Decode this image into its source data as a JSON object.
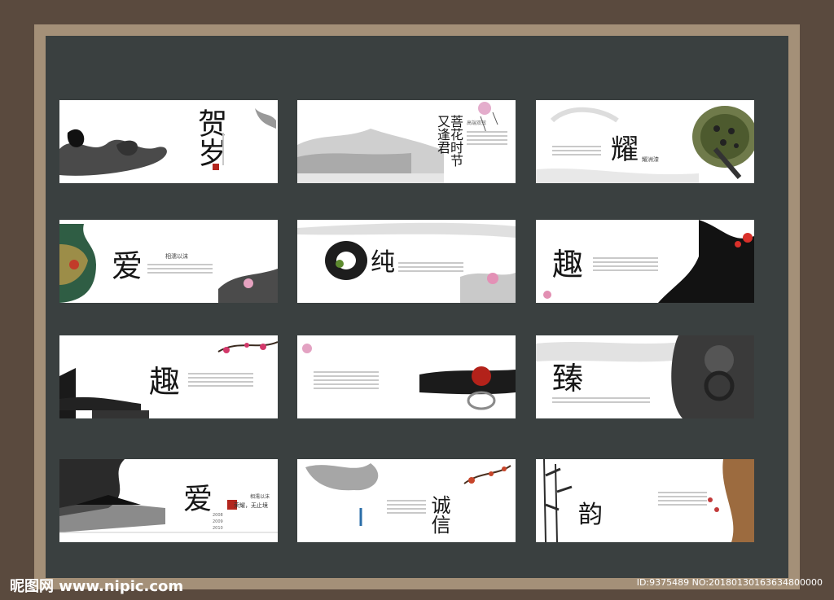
{
  "watermark": {
    "left": "昵图网 www.nipic.com",
    "right": "ID:9375489 NO:20180130163634800000"
  },
  "cards": [
    {
      "title": "贺岁",
      "small": ""
    },
    {
      "title": "菩花时节 又逢君",
      "small": "高端双效"
    },
    {
      "title": "耀",
      "small": "耀洲漆"
    },
    {
      "title": "爱",
      "small": "相濡以沫"
    },
    {
      "title": "纯",
      "small": ""
    },
    {
      "title": "趣",
      "small": ""
    },
    {
      "title": "趣",
      "small": ""
    },
    {
      "title": "",
      "small": ""
    },
    {
      "title": "臻",
      "small": ""
    },
    {
      "title": "爱",
      "small": "相濡以沫",
      "sub": "荣耀，无止境",
      "years": [
        "2008",
        "2009",
        "2010"
      ]
    },
    {
      "title": "诚信",
      "small": ""
    },
    {
      "title": "韵",
      "small": ""
    }
  ]
}
